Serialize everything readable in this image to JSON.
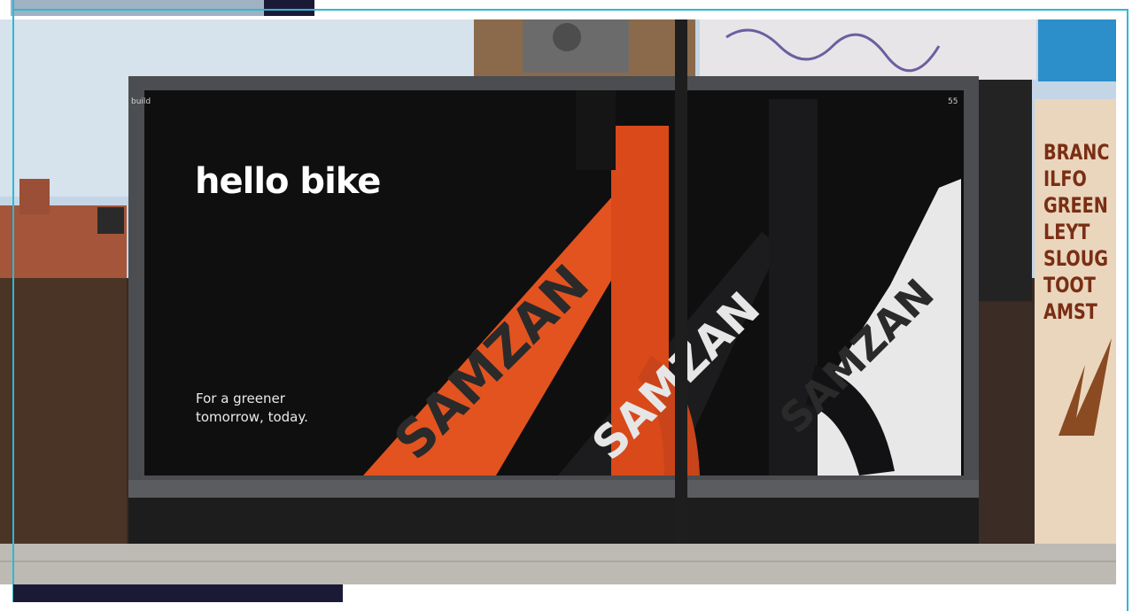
{
  "billboard": {
    "brand_logo": "hello bike",
    "tagline_lines": [
      "For a greener",
      "tomorrow, today."
    ],
    "frame_brand": "SAMZAN",
    "board_operator": "build",
    "board_code": "55",
    "colors": {
      "billboard_background": "#0f0f10",
      "orange_frame": "#e2531f",
      "black_frame": "#1c1c1e",
      "white_frame": "#e8e8e8",
      "sky": "#bcd2e4",
      "brick": "#3a2a22",
      "pavement": "#bdbab3"
    }
  },
  "wall_poster": {
    "lines": [
      "BRANC",
      "ILFO",
      "GREEN",
      "LEYT",
      "SLOUG",
      "TOOT",
      "AMST"
    ]
  },
  "page_decor": {
    "accent_outline": "#2fb7d6",
    "dark_bar": "#1b1a36"
  }
}
